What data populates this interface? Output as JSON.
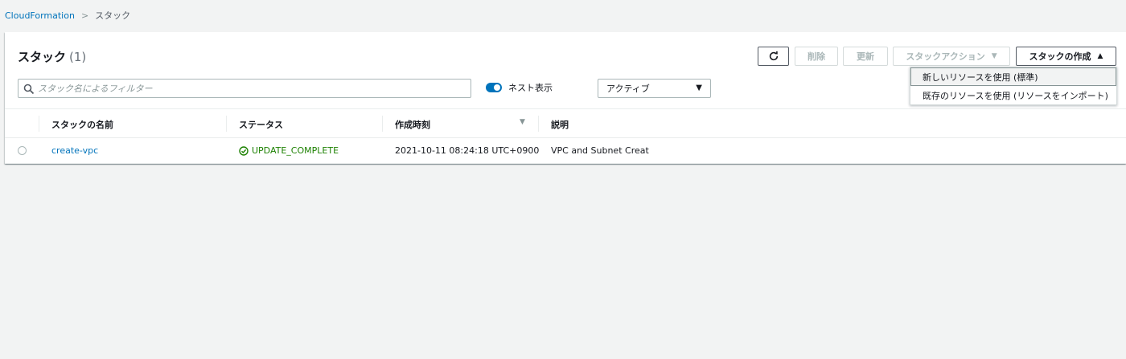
{
  "breadcrumb": {
    "root": "CloudFormation",
    "separator": ">",
    "current": "スタック"
  },
  "panel": {
    "title": "スタック",
    "count": "(1)"
  },
  "toolbar": {
    "refresh_icon": "refresh-icon",
    "delete_label": "削除",
    "update_label": "更新",
    "actions_label": "スタックアクション",
    "create_label": "スタックの作成"
  },
  "filter": {
    "placeholder": "スタック名によるフィルター",
    "value": ""
  },
  "nested_toggle": {
    "label": "ネスト表示",
    "on": true
  },
  "status_select": {
    "value": "アクティブ"
  },
  "table": {
    "columns": [
      "スタックの名前",
      "ステータス",
      "作成時刻",
      "説明"
    ],
    "rows": [
      {
        "name": "create-vpc",
        "status": "UPDATE_COMPLETE",
        "created": "2021-10-11 08:24:18 UTC+0900",
        "description": "VPC and Subnet Creat"
      }
    ]
  },
  "create_menu": {
    "items": [
      "新しいリソースを使用 (標準)",
      "既存のリソースを使用 (リソースをインポート)"
    ]
  },
  "colors": {
    "link": "#0073bb",
    "success": "#1d8102",
    "background": "#f2f3f3"
  }
}
